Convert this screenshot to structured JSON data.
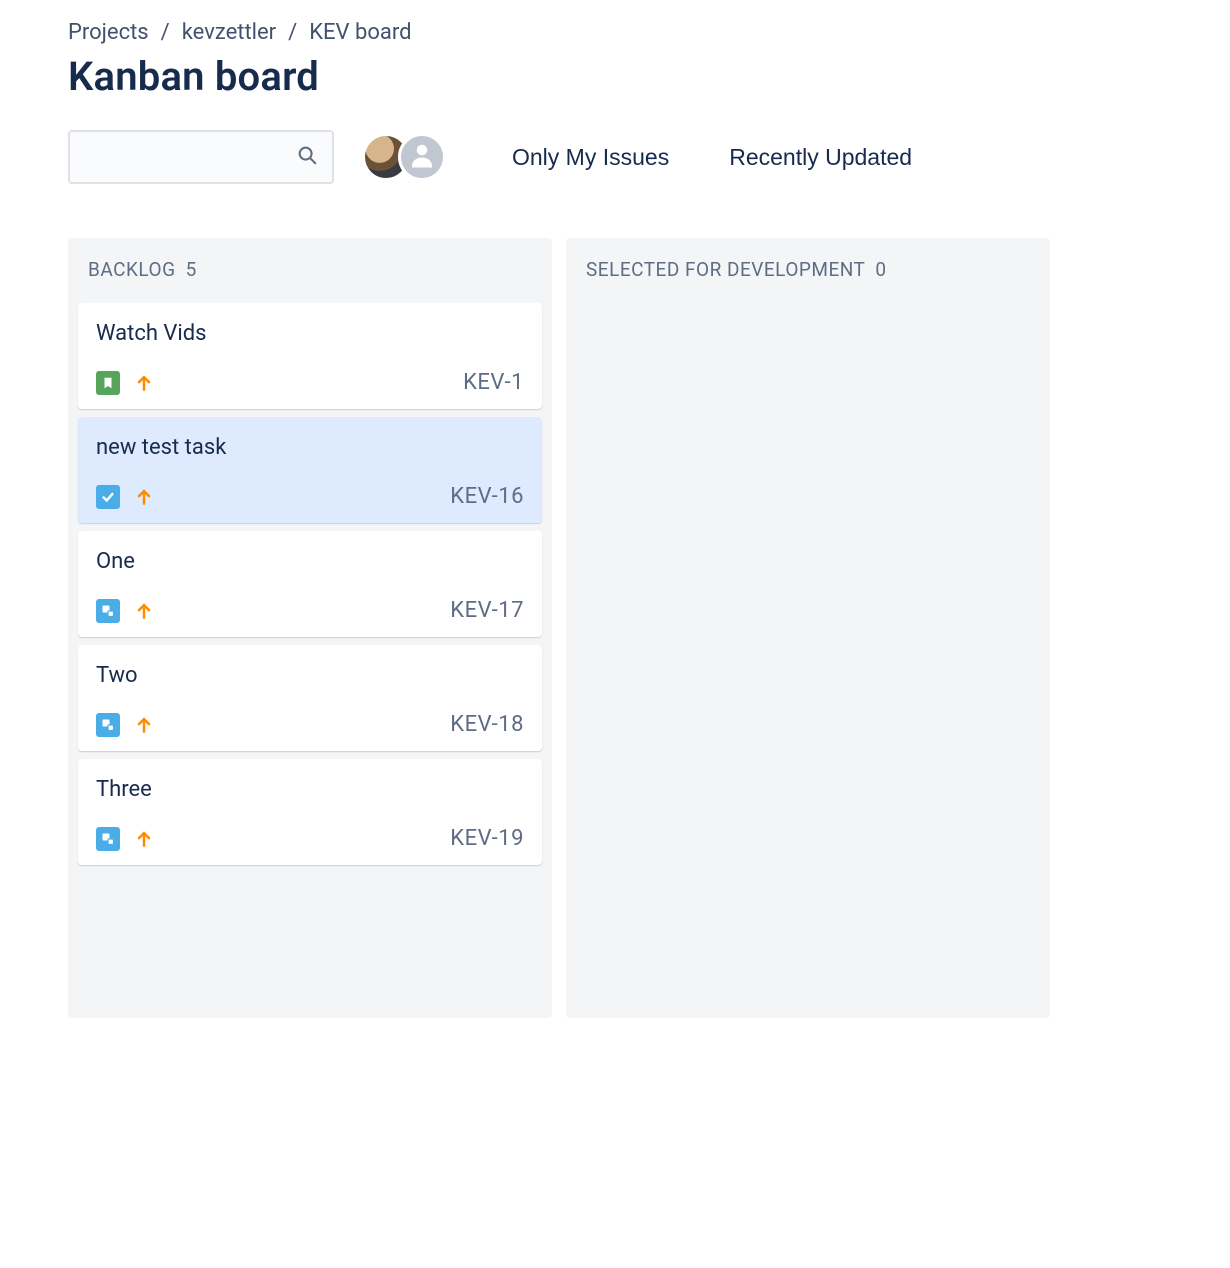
{
  "breadcrumb": {
    "root": "Projects",
    "project": "kevzettler",
    "board": "KEV board"
  },
  "page_title": "Kanban board",
  "search": {
    "placeholder": ""
  },
  "filters": {
    "only_my_issues": "Only My Issues",
    "recently_updated": "Recently Updated"
  },
  "avatars": [
    {
      "kind": "photo",
      "name": "user-1"
    },
    {
      "kind": "placeholder",
      "name": "unassigned"
    }
  ],
  "columns": [
    {
      "title": "Backlog",
      "count": 5,
      "cards": [
        {
          "title": "Watch Vids",
          "key": "KEV-1",
          "type": "story",
          "priority": "medium",
          "selected": false
        },
        {
          "title": "new test task",
          "key": "KEV-16",
          "type": "task",
          "priority": "medium",
          "selected": true
        },
        {
          "title": "One",
          "key": "KEV-17",
          "type": "subtask",
          "priority": "medium",
          "selected": false
        },
        {
          "title": "Two",
          "key": "KEV-18",
          "type": "subtask",
          "priority": "medium",
          "selected": false
        },
        {
          "title": "Three",
          "key": "KEV-19",
          "type": "subtask",
          "priority": "medium",
          "selected": false
        }
      ]
    },
    {
      "title": "Selected for Development",
      "count": 0,
      "cards": []
    }
  ]
}
